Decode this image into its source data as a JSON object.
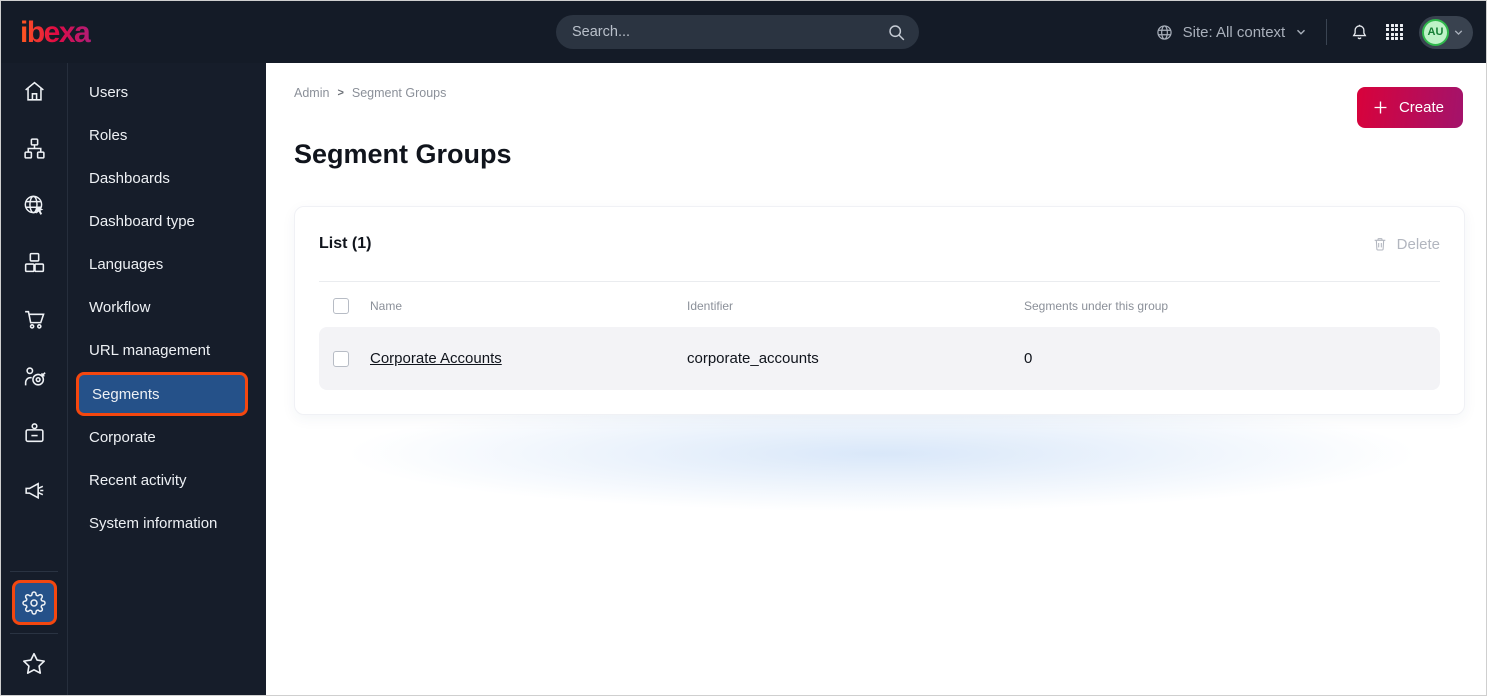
{
  "topbar": {
    "logo_text": "ibexa",
    "search_placeholder": "Search...",
    "site_context_label": "Site: All context",
    "avatar_initials": "AU"
  },
  "sidebar": {
    "menu": [
      "Users",
      "Roles",
      "Dashboards",
      "Dashboard type",
      "Languages",
      "Workflow",
      "URL management",
      "Segments",
      "Corporate",
      "Recent activity",
      "System information"
    ],
    "active_item": "Segments"
  },
  "main": {
    "breadcrumb": {
      "items": [
        "Admin",
        "Segment Groups"
      ],
      "separator": ">"
    },
    "title": "Segment Groups",
    "create_button_label": "Create",
    "list_panel": {
      "title": "List (1)",
      "delete_button_label": "Delete",
      "columns": [
        "Name",
        "Identifier",
        "Segments under this group"
      ],
      "rows": [
        {
          "name": "Corporate Accounts",
          "identifier": "corporate_accounts",
          "segments_under_group": "0"
        }
      ]
    }
  },
  "icons": {
    "search-icon": "magnifier",
    "site-globe-icon": "globe",
    "chevron-down-icon": "chevron-down",
    "notifications-bell-icon": "bell",
    "apps-grid-icon": "dot-grid",
    "home-icon": "house",
    "content-structure-icon": "sitemap",
    "site-management-icon": "globe-cursor",
    "product-catalog-icon": "boxes",
    "commerce-cart-icon": "shopping-cart",
    "personalization-icon": "person-target",
    "customer-portal-icon": "id-badge",
    "marketing-icon": "megaphone",
    "settings-gear-icon": "gear",
    "bookmarks-star-icon": "star",
    "plus-icon": "plus",
    "trash-icon": "trash"
  },
  "colors": {
    "topbar_bg": "#141b27",
    "sidebar_bg": "#161d2a",
    "active_item_bg": "#255189",
    "annotation_orange": "#f4470f",
    "create_gradient_start": "#d8023b",
    "create_gradient_end": "#a3136b",
    "avatar_green_border": "#30b84c",
    "avatar_green_bg": "#bff3c8",
    "row_bg": "#f3f3f6"
  }
}
